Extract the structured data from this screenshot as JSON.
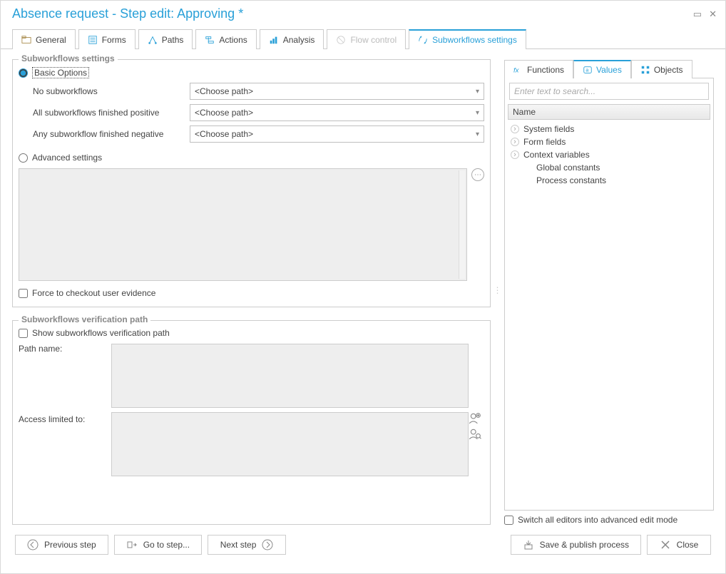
{
  "window": {
    "title": "Absence request - Step edit: Approving *"
  },
  "tabs": [
    {
      "label": "General"
    },
    {
      "label": "Forms"
    },
    {
      "label": "Paths"
    },
    {
      "label": "Actions"
    },
    {
      "label": "Analysis"
    },
    {
      "label": "Flow control",
      "disabled": true
    },
    {
      "label": "Subworkflows settings",
      "active": true
    }
  ],
  "subwf": {
    "group_title": "Subworkflows settings",
    "basic_label": "Basic Options",
    "rows": {
      "no_sub": {
        "label": "No subworkflows",
        "value": "<Choose path>"
      },
      "all_pos": {
        "label": "All subworkflows finished positive",
        "value": "<Choose path>"
      },
      "any_neg": {
        "label": "Any subworkflow finished negative",
        "value": "<Choose path>"
      }
    },
    "advanced_label": "Advanced settings",
    "force_checkout": "Force to checkout user evidence"
  },
  "verif": {
    "group_title": "Subworkflows verification path",
    "show_label": "Show subworkflows verification path",
    "path_name_label": "Path name:",
    "access_label": "Access limited to:"
  },
  "right": {
    "tabs": {
      "functions": "Functions",
      "values": "Values",
      "objects": "Objects"
    },
    "search_placeholder": "Enter text to search...",
    "name_header": "Name",
    "tree": {
      "system_fields": "System fields",
      "form_fields": "Form fields",
      "context_vars": "Context variables",
      "global_const": "Global constants",
      "process_const": "Process constants"
    },
    "switch_adv": "Switch all editors into advanced edit mode"
  },
  "footer": {
    "prev": "Previous step",
    "goto": "Go to step...",
    "next": "Next step",
    "save": "Save & publish process",
    "close": "Close"
  }
}
